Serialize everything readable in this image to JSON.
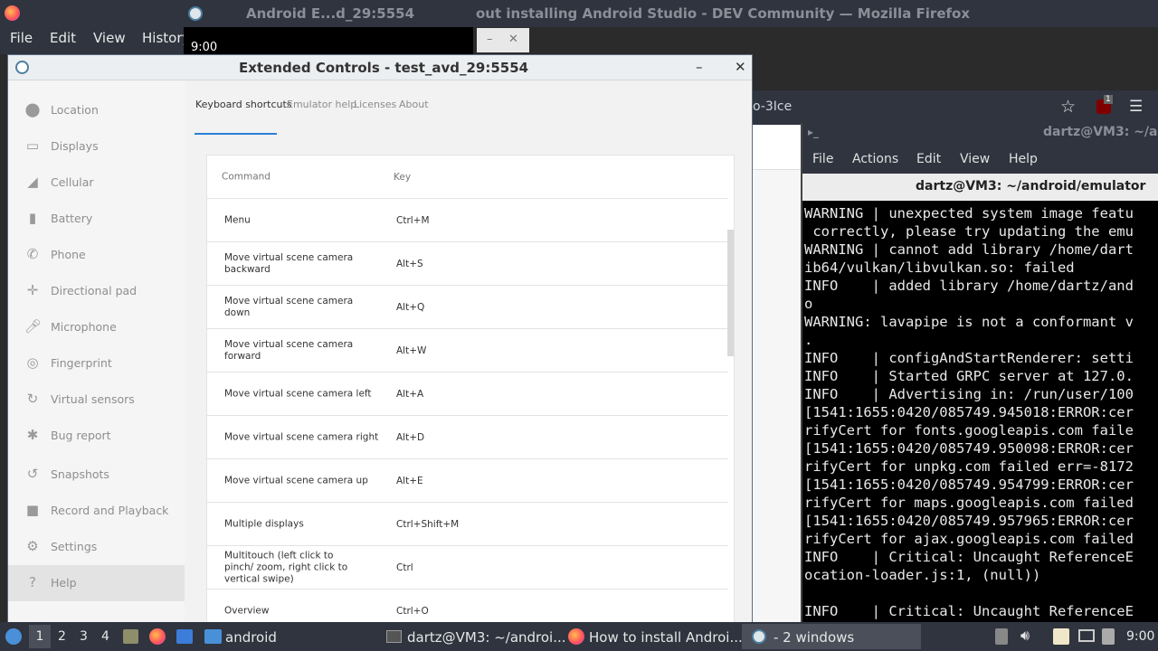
{
  "top_title": {
    "left": "Android E...d_29:5554",
    "right": "out installing Android Studio - DEV Community — Mozilla Firefox"
  },
  "firefox_menu": [
    "File",
    "Edit",
    "View",
    "History"
  ],
  "black_time": "9:00",
  "smallwin": {
    "min": "–",
    "close": "✕"
  },
  "firefox_url_fragment": "o-3Ice",
  "firefox_badge": "1",
  "ec": {
    "title": "Extended Controls - test_avd_29:5554",
    "min": "–",
    "close": "✕",
    "sidebar": [
      {
        "label": "Location",
        "icon": "location-pin-icon"
      },
      {
        "label": "Displays",
        "icon": "monitor-icon"
      },
      {
        "label": "Cellular",
        "icon": "signal-icon"
      },
      {
        "label": "Battery",
        "icon": "battery-icon"
      },
      {
        "label": "Phone",
        "icon": "phone-icon"
      },
      {
        "label": "Directional pad",
        "icon": "dpad-icon"
      },
      {
        "label": "Microphone",
        "icon": "microphone-icon"
      },
      {
        "label": "Fingerprint",
        "icon": "fingerprint-icon"
      },
      {
        "label": "Virtual sensors",
        "icon": "sensors-icon"
      },
      {
        "label": "Bug report",
        "icon": "bug-icon"
      },
      {
        "label": "Snapshots",
        "icon": "snapshots-icon"
      },
      {
        "label": "Record and Playback",
        "icon": "video-camera-icon"
      },
      {
        "label": "Settings",
        "icon": "gear-icon"
      },
      {
        "label": "Help",
        "icon": "help-icon"
      }
    ],
    "tabs": [
      "Keyboard shortcuts",
      "Emulator help",
      "Licenses",
      "About"
    ],
    "table": {
      "headers": {
        "command": "Command",
        "key": "Key"
      },
      "rows": [
        {
          "cmd": "Menu",
          "key": "Ctrl+M"
        },
        {
          "cmd": "Move virtual scene camera backward",
          "key": "Alt+S"
        },
        {
          "cmd": "Move virtual scene camera down",
          "key": "Alt+Q"
        },
        {
          "cmd": "Move virtual scene camera forward",
          "key": "Alt+W"
        },
        {
          "cmd": "Move virtual scene camera left",
          "key": "Alt+A"
        },
        {
          "cmd": "Move virtual scene camera right",
          "key": "Alt+D"
        },
        {
          "cmd": "Move virtual scene camera up",
          "key": "Alt+E"
        },
        {
          "cmd": "Multiple displays",
          "key": "Ctrl+Shift+M"
        },
        {
          "cmd": "Multitouch (left click to pinch/ zoom, right click to vertical swipe)",
          "key": "Ctrl"
        },
        {
          "cmd": "Overview",
          "key": "Ctrl+O"
        }
      ]
    }
  },
  "terminal": {
    "title": "dartz@VM3: ~/a",
    "menu": [
      "File",
      "Actions",
      "Edit",
      "View",
      "Help"
    ],
    "tab": "dartz@VM3: ~/android/emulator",
    "lines": [
      "WARNING | unexpected system image featu",
      " correctly, please try updating the emu",
      "WARNING | cannot add library /home/dart",
      "ib64/vulkan/libvulkan.so: failed",
      "INFO    | added library /home/dartz/and",
      "o",
      "WARNING: lavapipe is not a conformant v",
      ".",
      "INFO    | configAndStartRenderer: setti",
      "INFO    | Started GRPC server at 127.0.",
      "INFO    | Advertising in: /run/user/100",
      "[1541:1655:0420/085749.945018:ERROR:cer",
      "rifyCert for fonts.googleapis.com faile",
      "[1541:1655:0420/085749.950098:ERROR:cer",
      "rifyCert for unpkg.com failed err=-8172",
      "[1541:1655:0420/085749.954799:ERROR:cer",
      "rifyCert for maps.googleapis.com failed",
      "[1541:1655:0420/085749.957965:ERROR:cer",
      "rifyCert for ajax.googleapis.com failed",
      "INFO    | Critical: Uncaught ReferenceE",
      "ocation-loader.js:1, (null))",
      "",
      "INFO    | Critical: Uncaught ReferenceE"
    ]
  },
  "taskbar": {
    "workspaces": [
      "1",
      "2",
      "3",
      "4"
    ],
    "tasks": [
      "android",
      "dartz@VM3: ~/androi...",
      "How to install Androi...",
      "- 2 windows"
    ],
    "time": "9:00"
  }
}
